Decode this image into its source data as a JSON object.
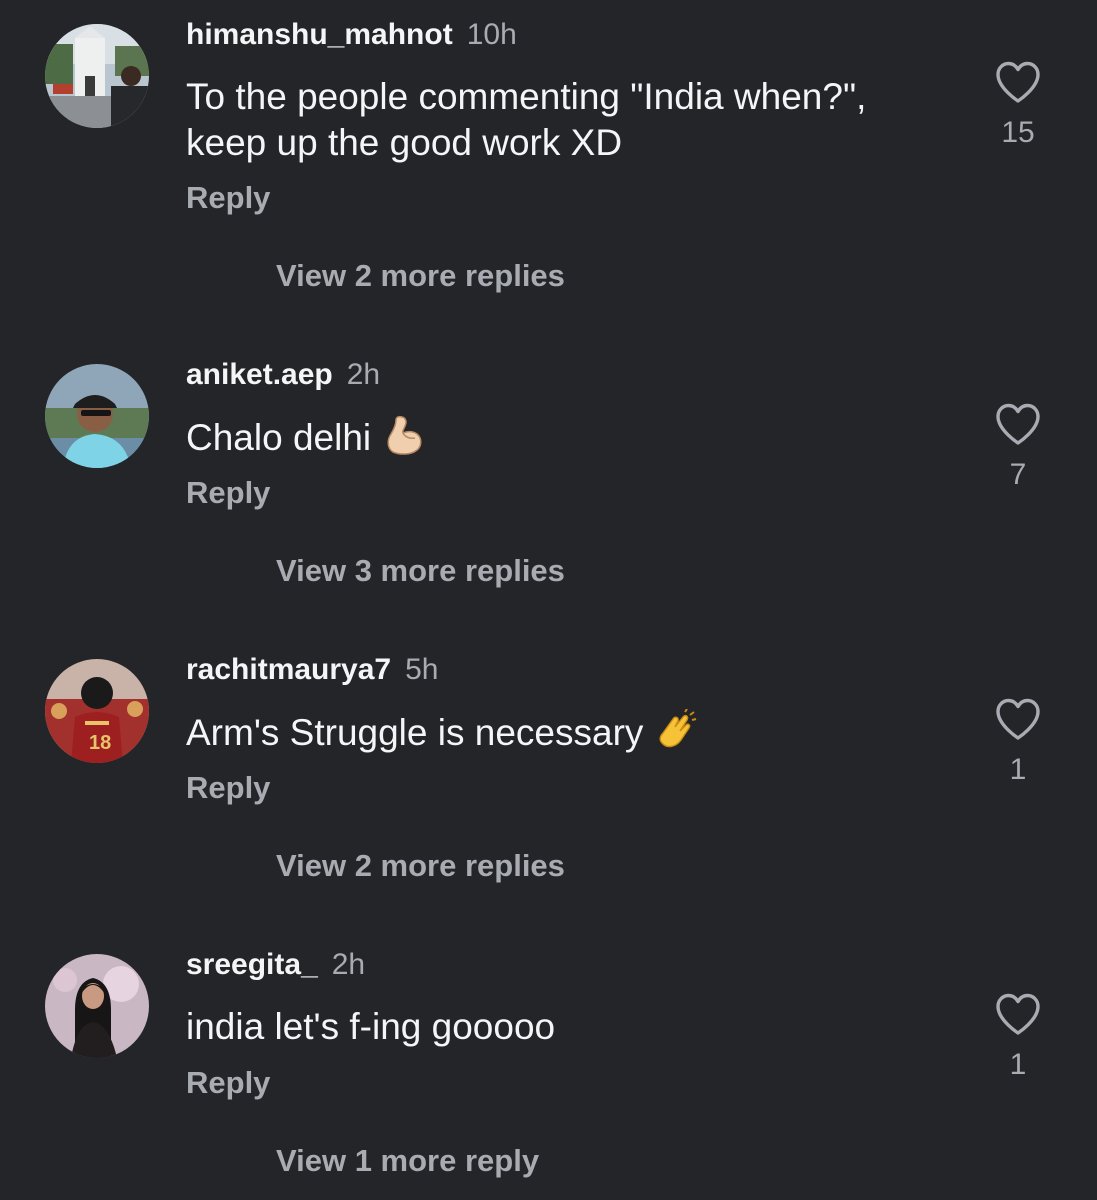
{
  "comments": [
    {
      "username": "himanshu_mahnot",
      "time": "10h",
      "text": "To the people commenting \"India when?\", keep up the good work XD",
      "reply_label": "Reply",
      "view_replies": "View 2 more replies",
      "likes": "15"
    },
    {
      "username": "aniket.aep",
      "time": "2h",
      "text": "Chalo delhi",
      "emoji": "flexed-biceps",
      "reply_label": "Reply",
      "view_replies": "View 3 more replies",
      "likes": "7"
    },
    {
      "username": "rachitmaurya7",
      "time": "5h",
      "text": "Arm's Struggle is necessary",
      "emoji": "clapping-hands",
      "reply_label": "Reply",
      "view_replies": "View 2 more replies",
      "likes": "1"
    },
    {
      "username": "sreegita_",
      "time": "2h",
      "text": "india let's f-ing gooooo",
      "reply_label": "Reply",
      "view_replies": "View 1 more reply",
      "likes": "1"
    }
  ],
  "colors": {
    "background": "#232528",
    "primary_text": "#f3f5f7",
    "secondary_text": "#a8abb1"
  },
  "icons": {
    "like": "heart-outline-icon"
  }
}
